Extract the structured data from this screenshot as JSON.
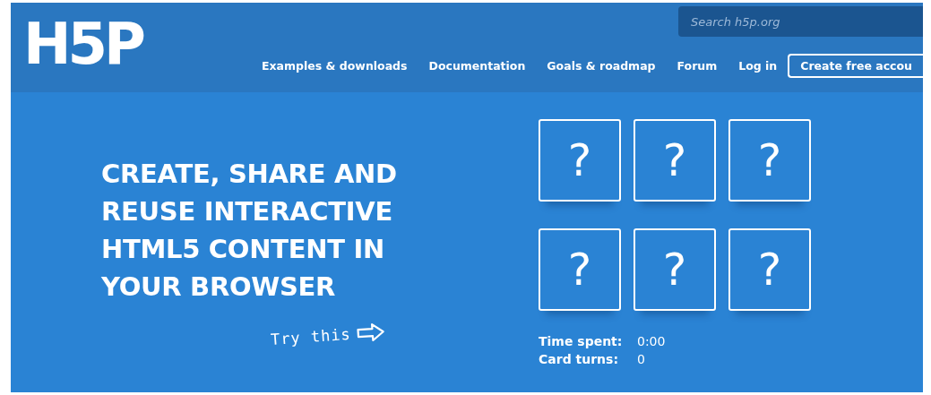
{
  "logo": {
    "text": "H5P"
  },
  "search": {
    "placeholder": "Search h5p.org"
  },
  "nav": [
    {
      "label": "Examples & downloads",
      "kind": "link"
    },
    {
      "label": "Documentation",
      "kind": "link"
    },
    {
      "label": "Goals & roadmap",
      "kind": "link"
    },
    {
      "label": "Forum",
      "kind": "link"
    },
    {
      "label": "Log in",
      "kind": "link"
    },
    {
      "label": "Create free accou",
      "kind": "button"
    }
  ],
  "hero": {
    "headline": "CREATE, SHARE AND REUSE INTERACTIVE HTML5 CONTENT IN YOUR BROWSER",
    "hint": "Try this"
  },
  "cards": [
    {
      "label": "?"
    },
    {
      "label": "?"
    },
    {
      "label": "?"
    },
    {
      "label": "?"
    },
    {
      "label": "?"
    },
    {
      "label": "?"
    }
  ],
  "stats": [
    {
      "label": "Time spent:",
      "value": "0:00"
    },
    {
      "label": "Card turns:",
      "value": "0"
    }
  ]
}
